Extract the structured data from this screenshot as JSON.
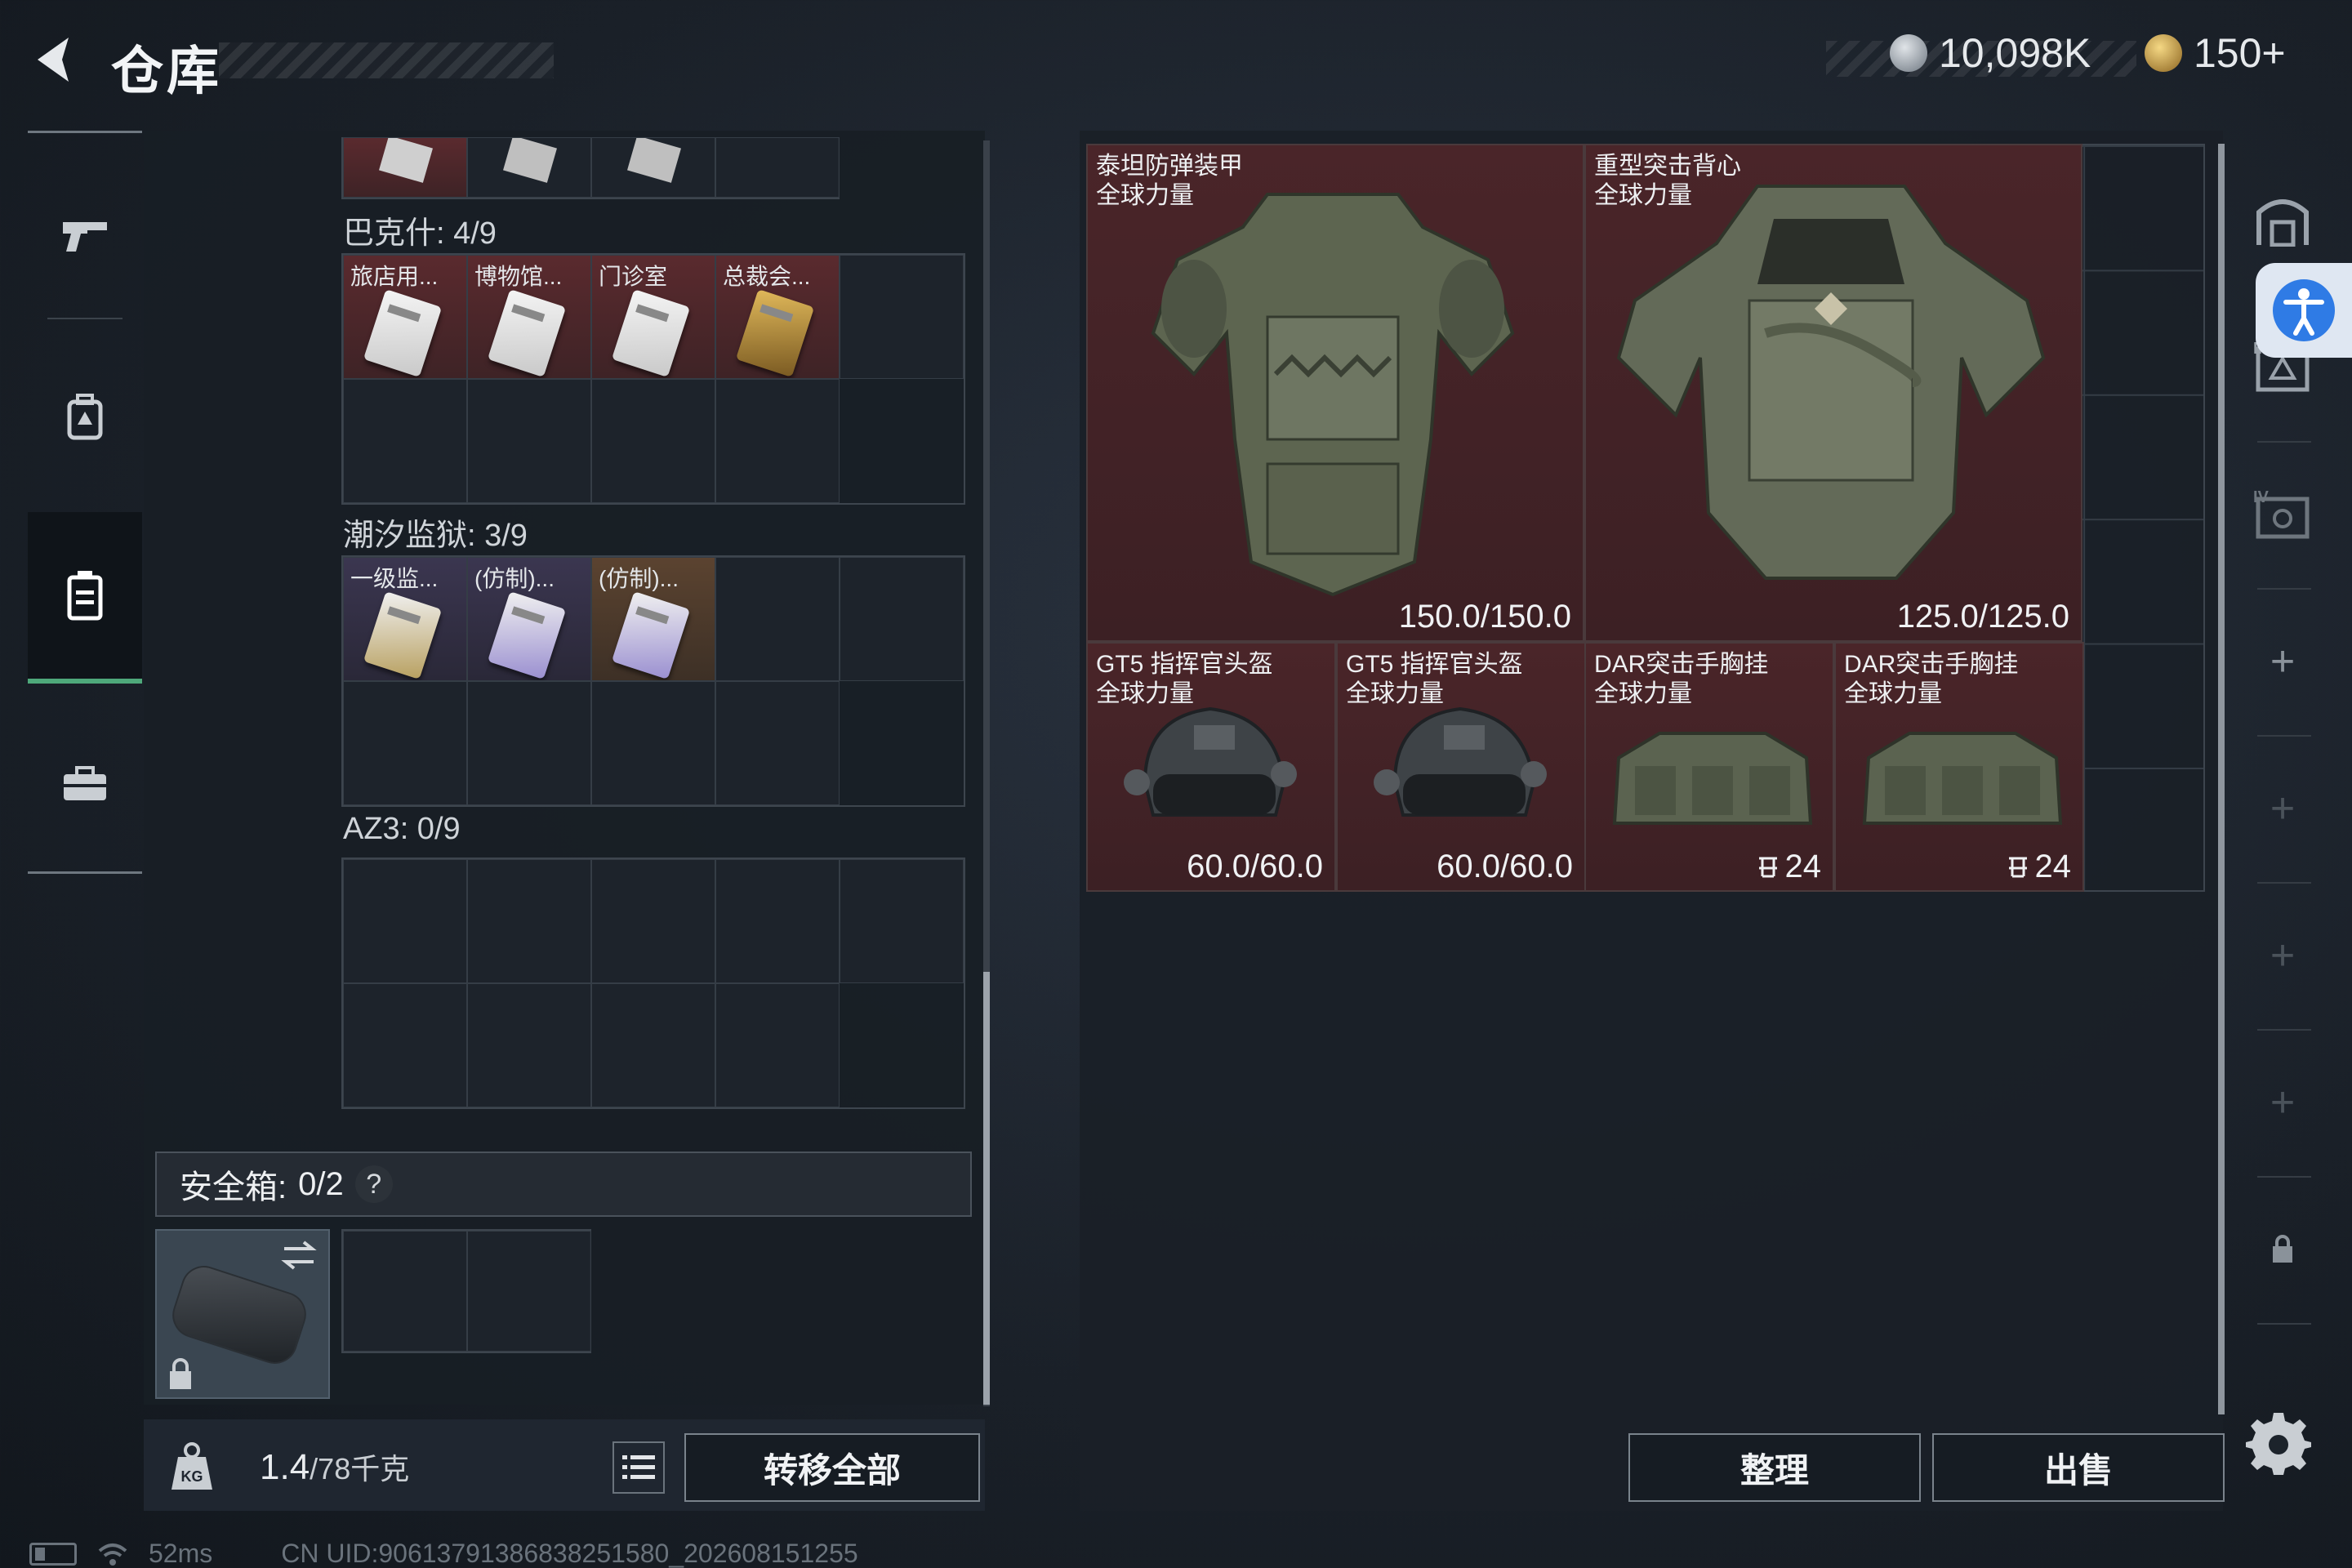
{
  "header": {
    "title": "仓库",
    "currency": [
      {
        "icon": "silver-coin-icon",
        "value": "10,098K",
        "color": "#9aa2ab"
      },
      {
        "icon": "gold-coin-icon",
        "value": "150+",
        "color": "#c9a24a"
      }
    ]
  },
  "left_nav": {
    "items": [
      {
        "icon": "gun-icon"
      },
      {
        "icon": "backpack-icon"
      },
      {
        "icon": "container-icon",
        "active": true
      },
      {
        "icon": "toolbox-icon"
      }
    ]
  },
  "inventory": {
    "sections": [
      {
        "label": "巴克什: 4/9",
        "items": [
          "旅店用...",
          "博物馆...",
          "门诊室",
          "总裁会..."
        ]
      },
      {
        "label": "潮汐监狱: 3/9",
        "items": [
          "一级监...",
          "(仿制)...",
          "(仿制)..."
        ]
      },
      {
        "label": "AZ3: 0/9",
        "items": []
      }
    ],
    "safe_box": {
      "label": "安全箱:",
      "count": "0/2",
      "help": "?"
    }
  },
  "footer_left": {
    "weight_value": "1.4",
    "weight_capacity": "/78千克",
    "transfer_all": "转移全部"
  },
  "stash": {
    "items": [
      {
        "name": "泰坦防弹装甲",
        "tag": "全球力量",
        "stat": "150.0/150.0"
      },
      {
        "name": "重型突击背心",
        "tag": "全球力量",
        "stat": "125.0/125.0"
      },
      {
        "name": "GT5 指挥官头盔",
        "tag": "全球力量",
        "stat": "60.0/60.0"
      },
      {
        "name": "GT5 指挥官头盔",
        "tag": "全球力量",
        "stat": "60.0/60.0"
      },
      {
        "name": "DAR突击手胸挂",
        "tag": "全球力量",
        "stat": "24"
      },
      {
        "name": "DAR突击手胸挂",
        "tag": "全球力量",
        "stat": "24"
      }
    ],
    "sort_label": "整理",
    "sell_label": "出售"
  },
  "status_bar": {
    "ping": "52ms",
    "uid": "CN UID:906137913868382515​80_202608151255"
  }
}
